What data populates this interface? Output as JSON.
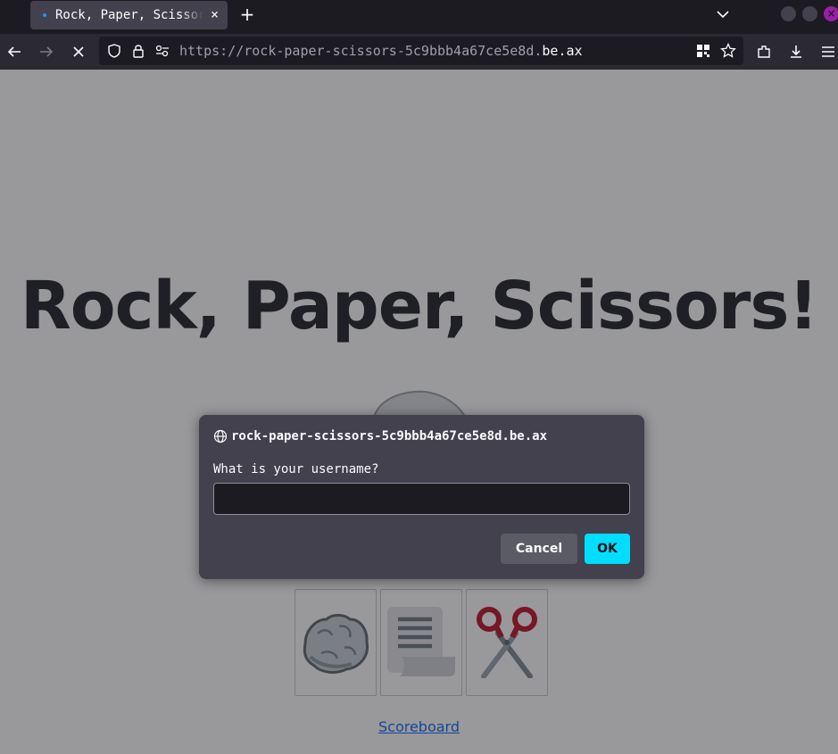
{
  "browser": {
    "tab_title": "Rock, Paper, Scissors!",
    "tab_close": "×",
    "new_tab": "+",
    "url_prefix": "https://rock-paper-scissors-5c9bbb4a67ce5e8d.",
    "url_domain": "be.ax"
  },
  "page": {
    "title": "Rock, Paper, Scissors!",
    "choices": [
      {
        "name": "rock"
      },
      {
        "name": "paper"
      },
      {
        "name": "scissors"
      }
    ],
    "scoreboard_link": "Scoreboard"
  },
  "dialog": {
    "origin": "rock-paper-scissors-5c9bbb4a67ce5e8d.be.ax",
    "message": "What is your username?",
    "input_value": "",
    "cancel_label": "Cancel",
    "ok_label": "OK"
  },
  "colors": {
    "accent": "#00ddff",
    "link": "#0d6efd",
    "dialog_bg": "#42414d"
  }
}
